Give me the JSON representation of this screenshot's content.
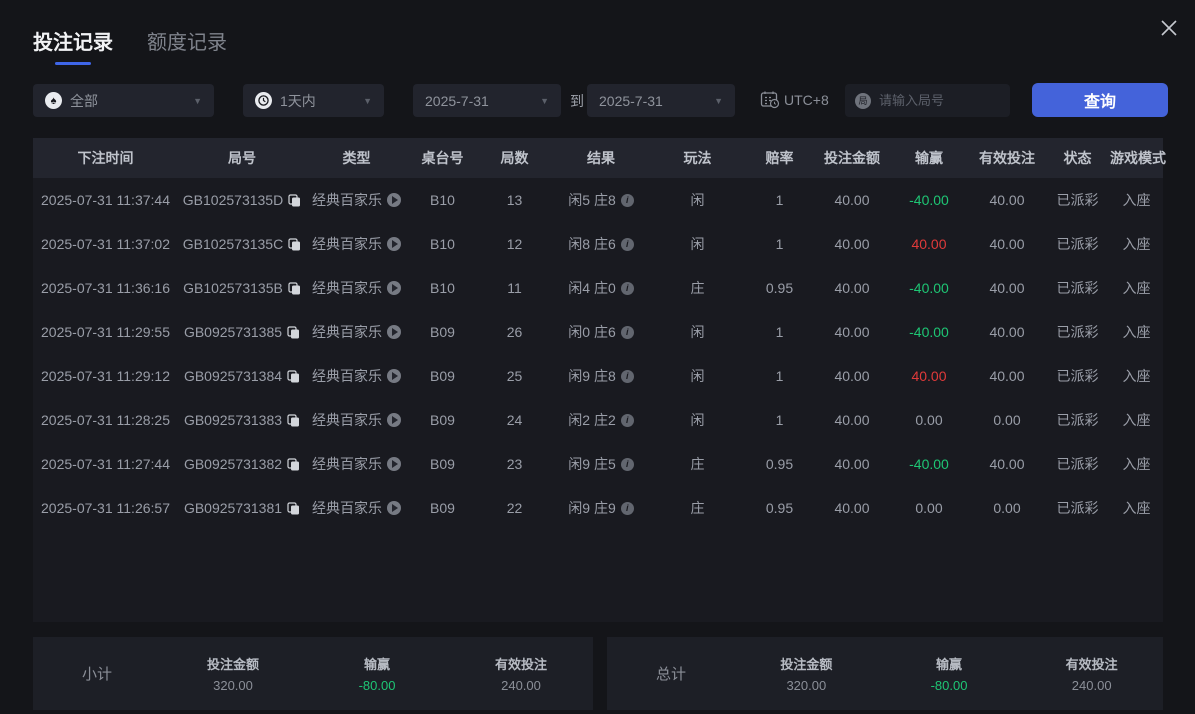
{
  "window": {
    "close_icon": "x-close"
  },
  "tabs": [
    {
      "label": "投注记录",
      "active": true
    },
    {
      "label": "额度记录",
      "active": false
    }
  ],
  "filters": {
    "game_type": {
      "value": "全部",
      "icon": "spade",
      "glyph": "♠"
    },
    "time_range": {
      "value": "1天内",
      "icon": "clock"
    },
    "date_from": "2025-7-31",
    "to_label": "到",
    "date_to": "2025-7-31",
    "timezone_label": "UTC+8",
    "round_icon_glyph": "局",
    "round_input_placeholder": "请输入局号",
    "search_button": "查询"
  },
  "table": {
    "headers": [
      "下注时间",
      "局号",
      "类型",
      "桌台号",
      "局数",
      "结果",
      "玩法",
      "赔率",
      "投注金额",
      "输赢",
      "有效投注",
      "状态",
      "游戏模式"
    ],
    "rows": [
      {
        "time": "2025-07-31 11:37:44",
        "round_id": "GB102573135D",
        "type": "经典百家乐",
        "table_no": "B10",
        "round_no": "13",
        "result": "闲5 庄8",
        "play": "闲",
        "odds": "1",
        "bet": "40.00",
        "winloss": "-40.00",
        "winloss_color": "green",
        "valid": "40.00",
        "status": "已派彩",
        "mode": "入座"
      },
      {
        "time": "2025-07-31 11:37:02",
        "round_id": "GB102573135C",
        "type": "经典百家乐",
        "table_no": "B10",
        "round_no": "12",
        "result": "闲8 庄6",
        "play": "闲",
        "odds": "1",
        "bet": "40.00",
        "winloss": "40.00",
        "winloss_color": "red",
        "valid": "40.00",
        "status": "已派彩",
        "mode": "入座"
      },
      {
        "time": "2025-07-31 11:36:16",
        "round_id": "GB102573135B",
        "type": "经典百家乐",
        "table_no": "B10",
        "round_no": "11",
        "result": "闲4 庄0",
        "play": "庄",
        "odds": "0.95",
        "bet": "40.00",
        "winloss": "-40.00",
        "winloss_color": "green",
        "valid": "40.00",
        "status": "已派彩",
        "mode": "入座"
      },
      {
        "time": "2025-07-31 11:29:55",
        "round_id": "GB0925731385",
        "type": "经典百家乐",
        "table_no": "B09",
        "round_no": "26",
        "result": "闲0 庄6",
        "play": "闲",
        "odds": "1",
        "bet": "40.00",
        "winloss": "-40.00",
        "winloss_color": "green",
        "valid": "40.00",
        "status": "已派彩",
        "mode": "入座"
      },
      {
        "time": "2025-07-31 11:29:12",
        "round_id": "GB0925731384",
        "type": "经典百家乐",
        "table_no": "B09",
        "round_no": "25",
        "result": "闲9 庄8",
        "play": "闲",
        "odds": "1",
        "bet": "40.00",
        "winloss": "40.00",
        "winloss_color": "red",
        "valid": "40.00",
        "status": "已派彩",
        "mode": "入座"
      },
      {
        "time": "2025-07-31 11:28:25",
        "round_id": "GB0925731383",
        "type": "经典百家乐",
        "table_no": "B09",
        "round_no": "24",
        "result": "闲2 庄2",
        "play": "闲",
        "odds": "1",
        "bet": "40.00",
        "winloss": "0.00",
        "winloss_color": "neutral",
        "valid": "0.00",
        "status": "已派彩",
        "mode": "入座"
      },
      {
        "time": "2025-07-31 11:27:44",
        "round_id": "GB0925731382",
        "type": "经典百家乐",
        "table_no": "B09",
        "round_no": "23",
        "result": "闲9 庄5",
        "play": "庄",
        "odds": "0.95",
        "bet": "40.00",
        "winloss": "-40.00",
        "winloss_color": "green",
        "valid": "40.00",
        "status": "已派彩",
        "mode": "入座"
      },
      {
        "time": "2025-07-31 11:26:57",
        "round_id": "GB0925731381",
        "type": "经典百家乐",
        "table_no": "B09",
        "round_no": "22",
        "result": "闲9 庄9",
        "play": "庄",
        "odds": "0.95",
        "bet": "40.00",
        "winloss": "0.00",
        "winloss_color": "neutral",
        "valid": "0.00",
        "status": "已派彩",
        "mode": "入座"
      }
    ]
  },
  "summary": {
    "subtotal": {
      "label": "小计",
      "bet_amount_label": "投注金额",
      "bet_amount": "320.00",
      "winloss_label": "输赢",
      "winloss": "-80.00",
      "valid_bet_label": "有效投注",
      "valid_bet": "240.00"
    },
    "total": {
      "label": "总计",
      "bet_amount_label": "投注金额",
      "bet_amount": "320.00",
      "winloss_label": "输赢",
      "winloss": "-80.00",
      "valid_bet_label": "有效投注",
      "valid_bet": "240.00"
    }
  },
  "colors": {
    "accent_blue": "#4463da",
    "tab_underline": "#3f66e8",
    "win_red": "#e03a3a",
    "loss_green": "#1ec574",
    "page_bg": "#141519",
    "table_bg": "#191a20",
    "header_bg": "#23252e",
    "panel_bg": "#1d1f26"
  }
}
